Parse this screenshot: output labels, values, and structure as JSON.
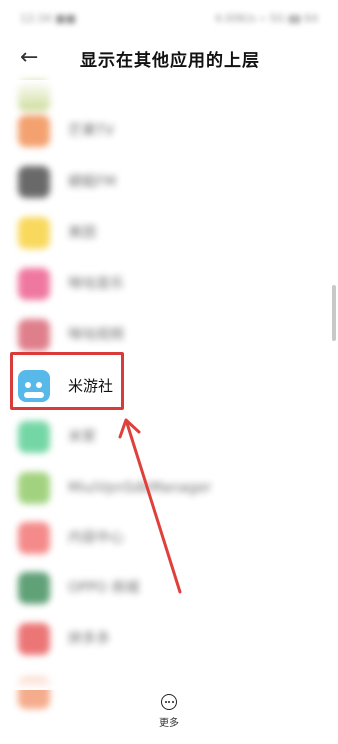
{
  "status_bar": {
    "left_text": "12:34 ■■",
    "right_text": "4.00K/s ⌁ 5G ▮▮ 64"
  },
  "header": {
    "title": "显示在其他应用的上层"
  },
  "apps": [
    {
      "label": "",
      "color": "#c6d68a",
      "blurred": true
    },
    {
      "label": "芒果TV",
      "color": "#ee7a33",
      "blurred": true
    },
    {
      "label": "蜻蜓FM",
      "color": "#2b2b2b",
      "blurred": true
    },
    {
      "label": "美团",
      "color": "#f6c91b",
      "blurred": true
    },
    {
      "label": "咪咕音乐",
      "color": "#e9407a",
      "blurred": true
    },
    {
      "label": "咪咕视频",
      "color": "#d24a5c",
      "blurred": true
    },
    {
      "label": "米游社",
      "color": "#56b9ea",
      "blurred": false
    },
    {
      "label": "米家",
      "color": "#3bc680",
      "blurred": true
    },
    {
      "label": "MiuiVpnSdkManager",
      "color": "#7cc04a",
      "blurred": true
    },
    {
      "label": "内容中心",
      "color": "#f05a5a",
      "blurred": true
    },
    {
      "label": "OPPO 商城",
      "color": "#1e7a3f",
      "blurred": true
    },
    {
      "label": "拼多多",
      "color": "#e43d3d",
      "blurred": true
    },
    {
      "label": "",
      "color": "#f08a5d",
      "blurred": true
    }
  ],
  "bottom": {
    "more_label": "更多"
  },
  "colors": {
    "highlight": "#d93a3a",
    "arrow": "#e0403c"
  }
}
